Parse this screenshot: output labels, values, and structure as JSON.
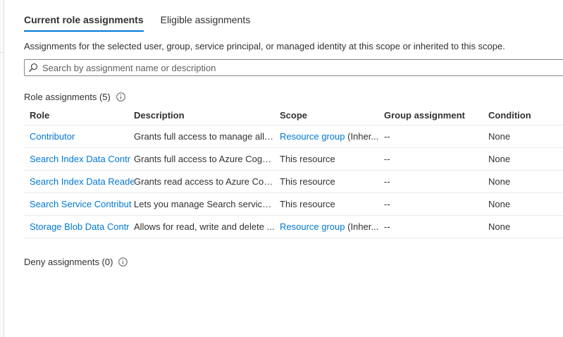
{
  "tabs": [
    {
      "label": "Current role assignments",
      "active": true
    },
    {
      "label": "Eligible assignments",
      "active": false
    }
  ],
  "description": "Assignments for the selected user, group, service principal, or managed identity at this scope or inherited to this scope.",
  "search": {
    "placeholder": "Search by assignment name or description",
    "value": ""
  },
  "role_assignments": {
    "title": "Role assignments (5)",
    "columns": [
      "Role",
      "Description",
      "Scope",
      "Group assignment",
      "Condition"
    ],
    "rows": [
      {
        "role": "Contributor",
        "description": "Grants full access to manage all r...",
        "scope_link": "Resource group",
        "scope_suffix": " (Inher...",
        "group": "--",
        "condition": "None"
      },
      {
        "role": "Search Index Data Contr",
        "description": "Grants full access to Azure Cogni...",
        "scope_link": "",
        "scope_suffix": "This resource",
        "group": "--",
        "condition": "None"
      },
      {
        "role": "Search Index Data Reade",
        "description": "Grants read access to Azure Cog...",
        "scope_link": "",
        "scope_suffix": "This resource",
        "group": "--",
        "condition": "None"
      },
      {
        "role": "Search Service Contribut",
        "description": "Lets you manage Search services...",
        "scope_link": "",
        "scope_suffix": "This resource",
        "group": "--",
        "condition": "None"
      },
      {
        "role": "Storage Blob Data Contr",
        "description": "Allows for read, write and delete ...",
        "scope_link": "Resource group",
        "scope_suffix": " (Inher...",
        "group": "--",
        "condition": "None"
      }
    ]
  },
  "deny_assignments": {
    "title": "Deny assignments (0)"
  },
  "colors": {
    "accent": "#0078d4",
    "text": "#323130",
    "border": "#edebe9"
  },
  "icons": {
    "search": "search-icon",
    "info": "info-icon"
  }
}
